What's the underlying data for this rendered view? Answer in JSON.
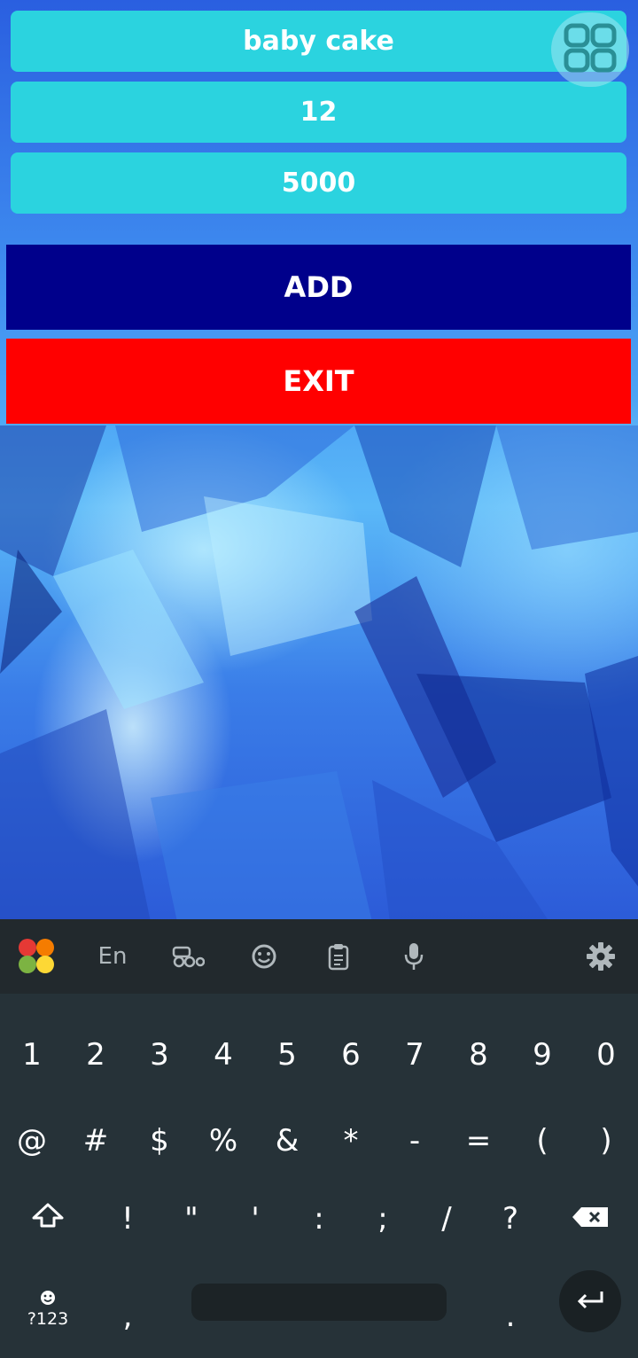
{
  "form": {
    "name_value": "baby cake",
    "quantity_value": "12",
    "price_value": "5000"
  },
  "buttons": {
    "add_label": "ADD",
    "exit_label": "EXIT"
  },
  "colors": {
    "field_bg": "#2bd3df",
    "add_bg": "#00008b",
    "exit_bg": "#ff0000",
    "keyboard_bg": "#263238"
  },
  "keyboard": {
    "toolbar": {
      "language_label": "En",
      "icons": [
        "app-logo-icon",
        "glasses-icon",
        "emoji-icon",
        "clipboard-icon",
        "microphone-icon",
        "settings-gear-icon"
      ]
    },
    "row1": [
      "1",
      "2",
      "3",
      "4",
      "5",
      "6",
      "7",
      "8",
      "9",
      "0"
    ],
    "row2": [
      "@",
      "#",
      "$",
      "%",
      "&",
      "*",
      "-",
      "=",
      "(",
      ")"
    ],
    "row3": [
      "!",
      "\"",
      "'",
      ":",
      ";",
      "/",
      "?"
    ],
    "bottom": {
      "symbols_label": "?123",
      "comma": ",",
      "period": "."
    }
  }
}
